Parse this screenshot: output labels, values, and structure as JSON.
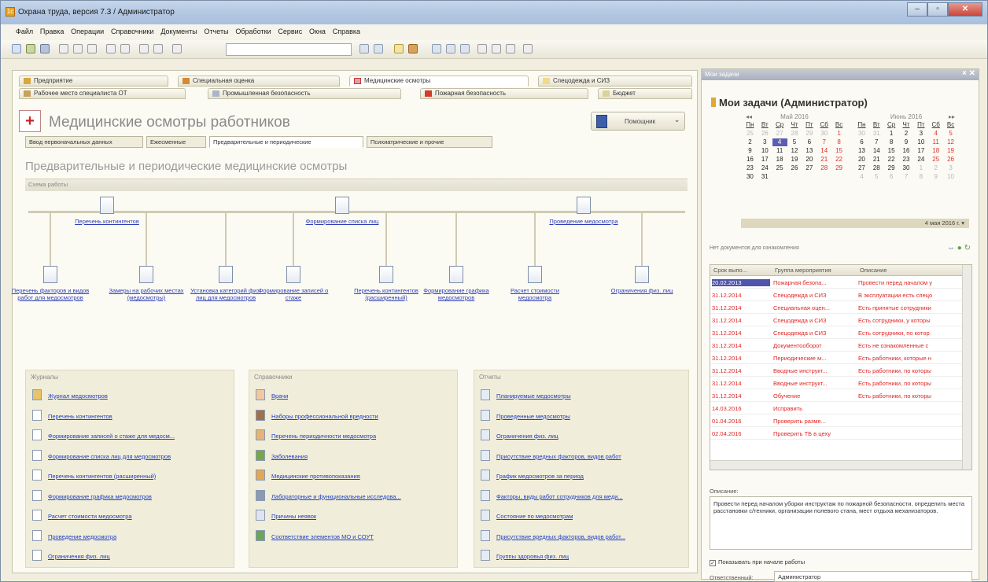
{
  "window": {
    "title": "Охрана труда, версия 7.3 / Администратор"
  },
  "menu": [
    "Файл",
    "Правка",
    "Операции",
    "Справочники",
    "Документы",
    "Отчеты",
    "Обработки",
    "Сервис",
    "Окна",
    "Справка"
  ],
  "tabs_row1": [
    "Предприятие",
    "Специальная оценка",
    "Медицинские осмотры",
    "Спецодежда и СИЗ"
  ],
  "tabs_row2": [
    "Рабочее место специалиста ОТ",
    "Промышленная безопасность",
    "Пожарная безопасность",
    "Бюджет"
  ],
  "page": {
    "title": "Медицинские осмотры работников",
    "help_button": "Помощник",
    "subtabs": [
      "Ввод первоначальных данных",
      "Ежесменные",
      "Предварительные и периодические",
      "Психиатрические и прочие"
    ],
    "section_title": "Предварительные и периодические медицинские осмотры",
    "scheme_label": "Схема работы",
    "scheme_top": [
      "Перечень контингентов",
      "Формирование списка лиц",
      "Проведение медосмотра"
    ],
    "scheme_bottom": [
      "Перечень факторов и видов работ для медосмотров",
      "Замеры на рабочих местах (медосмотры)",
      "Установка категорий физ. лиц для медосмотров",
      "Формирование записей о стаже",
      "Перечень контингентов (расширенный)",
      "Формирование графика медосмотров",
      "Расчет стоимости медосмотра",
      "Ограничения физ. лиц"
    ]
  },
  "panels": {
    "journals": {
      "title": "Журналы",
      "items": [
        "Журнал медосмотров",
        "Перечень контингентов",
        "Формирование записей о стаже для медосм...",
        "Формирование списка лиц для медосмотров",
        "Перечень контингентов (расширенный)",
        "Формирование графика медосмотров",
        "Расчет стоимости медосмотра",
        "Проведение медосмотра",
        "Ограничения физ. лиц"
      ]
    },
    "refs": {
      "title": "Справочники",
      "items": [
        "Врачи",
        "Наборы профессиональной вредности",
        "Перечень периодичности медосмотра",
        "Заболевания",
        "Медицинские противопоказания",
        "Лабораторные и функциональные исследова...",
        "Причины неявок",
        "Соответствие элементов МО и СОУТ"
      ]
    },
    "reports": {
      "title": "Отчеты",
      "items": [
        "Планируемые медосмотры",
        "Проведенные медосмотры",
        "Ограничения физ. лиц",
        "Присутствие вредных факторов, видов работ",
        "График медосмотров за период",
        "Факторы, виды работ сотрудников для меди...",
        "Состояние по медосмотрам",
        "Присутствие вредных факторов, видов работ...",
        "Группы здоровья физ. лиц"
      ]
    }
  },
  "side": {
    "header": "Мои задачи",
    "title": "Мои задачи (Администратор)",
    "cal1": {
      "month": "Май 2016",
      "nav": "◂◂"
    },
    "cal2": {
      "month": "Июнь 2016",
      "nav": "▸▸"
    },
    "weekdays": [
      "Пн",
      "Вт",
      "Ср",
      "Чт",
      "Пт",
      "Сб",
      "Вс"
    ],
    "today": "4 мая 2016 г.",
    "no_docs": "Нет документов для ознакомления",
    "table_headers": [
      "Срок выпо...",
      "Группа мероприятия",
      "Описание"
    ],
    "rows": [
      [
        "20.02.2013",
        "Пожарная безопа...",
        "Провести перед началом у"
      ],
      [
        "31.12.2014",
        "Спецодежда и СИЗ",
        "В эксплуатации есть спецо"
      ],
      [
        "31.12.2014",
        "Специальная оцен...",
        "Есть принятые сотрудники"
      ],
      [
        "31.12.2014",
        "Спецодежда и СИЗ",
        "Есть сотрудники, у которы"
      ],
      [
        "31.12.2014",
        "Спецодежда и СИЗ",
        "Есть сотрудники, по котор"
      ],
      [
        "31.12.2014",
        "Документооборот",
        "Есть не ознакомленные с"
      ],
      [
        "31.12.2014",
        "Периодические м...",
        "Есть работники, которые н"
      ],
      [
        "31.12.2014",
        "Вводные инструкт...",
        "Есть работники, по которы"
      ],
      [
        "31.12.2014",
        "Вводные инструкт...",
        "Есть работники, по которы"
      ],
      [
        "31.12.2014",
        "Обучение",
        "Есть работники, по которы"
      ],
      [
        "14.03.2016",
        "Исправить",
        ""
      ],
      [
        "01.04.2016",
        "Проверить разме...",
        ""
      ],
      [
        "02.04.2016",
        "Проверить ТБ в цеху",
        ""
      ]
    ],
    "desc_label": "Описание:",
    "desc_text": "Провести перед началом уборки инструктаж по пожарной безопасности, определить места расстановки с/техники, организации полевого стана, мест отдыха механизаторов.",
    "show_check": "Показывать при начале работы",
    "resp_label": "Ответственный:",
    "resp_value": "Администратор"
  }
}
